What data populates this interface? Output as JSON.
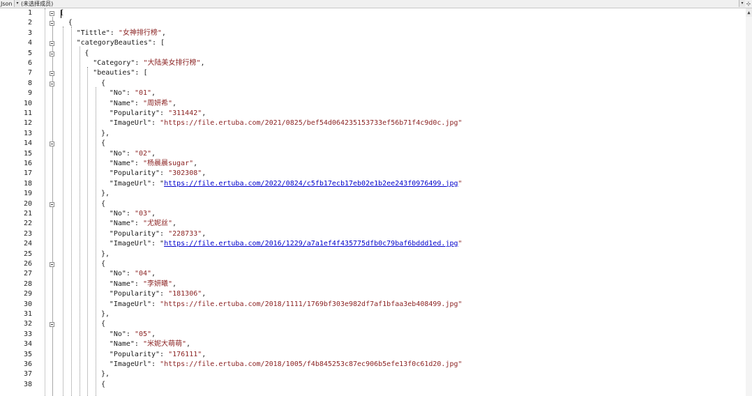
{
  "navbar": {
    "type_label": "Json",
    "member_label": "(未选择成员)",
    "dropdown_glyph": "▾",
    "split_glyph": "⊹"
  },
  "scroll": {
    "up_glyph": "▲"
  },
  "line_numbers": [
    "1",
    "2",
    "3",
    "4",
    "5",
    "6",
    "7",
    "8",
    "9",
    "10",
    "11",
    "12",
    "13",
    "14",
    "15",
    "16",
    "17",
    "18",
    "19",
    "20",
    "21",
    "22",
    "23",
    "24",
    "25",
    "26",
    "27",
    "28",
    "29",
    "30",
    "31",
    "32",
    "33",
    "34",
    "35",
    "36",
    "37",
    "38"
  ],
  "lines": [
    {
      "indent": 0,
      "parts": [
        {
          "t": "[",
          "c": "p"
        }
      ]
    },
    {
      "indent": 1,
      "parts": [
        {
          "t": "{",
          "c": "p"
        }
      ]
    },
    {
      "indent": 2,
      "parts": [
        {
          "t": "\"Tittle\"",
          "c": "k"
        },
        {
          "t": ": ",
          "c": "p"
        },
        {
          "t": "\"女神排行榜\"",
          "c": "v"
        },
        {
          "t": ",",
          "c": "p"
        }
      ]
    },
    {
      "indent": 2,
      "parts": [
        {
          "t": "\"categoryBeauties\"",
          "c": "k"
        },
        {
          "t": ": [",
          "c": "p"
        }
      ]
    },
    {
      "indent": 3,
      "parts": [
        {
          "t": "{",
          "c": "p"
        }
      ]
    },
    {
      "indent": 4,
      "parts": [
        {
          "t": "\"Category\"",
          "c": "k"
        },
        {
          "t": ": ",
          "c": "p"
        },
        {
          "t": "\"大陆美女排行榜\"",
          "c": "v"
        },
        {
          "t": ",",
          "c": "p"
        }
      ]
    },
    {
      "indent": 4,
      "parts": [
        {
          "t": "\"beauties\"",
          "c": "k"
        },
        {
          "t": ": [",
          "c": "p"
        }
      ]
    },
    {
      "indent": 5,
      "parts": [
        {
          "t": "{",
          "c": "p"
        }
      ]
    },
    {
      "indent": 6,
      "parts": [
        {
          "t": "\"No\"",
          "c": "k"
        },
        {
          "t": ": ",
          "c": "p"
        },
        {
          "t": "\"01\"",
          "c": "v"
        },
        {
          "t": ",",
          "c": "p"
        }
      ]
    },
    {
      "indent": 6,
      "parts": [
        {
          "t": "\"Name\"",
          "c": "k"
        },
        {
          "t": ": ",
          "c": "p"
        },
        {
          "t": "\"周妍希\"",
          "c": "v"
        },
        {
          "t": ",",
          "c": "p"
        }
      ]
    },
    {
      "indent": 6,
      "parts": [
        {
          "t": "\"Popularity\"",
          "c": "k"
        },
        {
          "t": ": ",
          "c": "p"
        },
        {
          "t": "\"311442\"",
          "c": "v"
        },
        {
          "t": ",",
          "c": "p"
        }
      ]
    },
    {
      "indent": 6,
      "parts": [
        {
          "t": "\"ImageUrl\"",
          "c": "k"
        },
        {
          "t": ": ",
          "c": "p"
        },
        {
          "t": "\"https://file.ertuba.com/2021/0825/bef54d064235153733ef56b71f4c9d0c.jpg\"",
          "c": "v"
        }
      ]
    },
    {
      "indent": 5,
      "parts": [
        {
          "t": "},",
          "c": "p"
        }
      ]
    },
    {
      "indent": 5,
      "parts": [
        {
          "t": "{",
          "c": "p"
        }
      ]
    },
    {
      "indent": 6,
      "parts": [
        {
          "t": "\"No\"",
          "c": "k"
        },
        {
          "t": ": ",
          "c": "p"
        },
        {
          "t": "\"02\"",
          "c": "v"
        },
        {
          "t": ",",
          "c": "p"
        }
      ]
    },
    {
      "indent": 6,
      "parts": [
        {
          "t": "\"Name\"",
          "c": "k"
        },
        {
          "t": ": ",
          "c": "p"
        },
        {
          "t": "\"杨晨晨sugar\"",
          "c": "v"
        },
        {
          "t": ",",
          "c": "p"
        }
      ]
    },
    {
      "indent": 6,
      "parts": [
        {
          "t": "\"Popularity\"",
          "c": "k"
        },
        {
          "t": ": ",
          "c": "p"
        },
        {
          "t": "\"302308\"",
          "c": "v"
        },
        {
          "t": ",",
          "c": "p"
        }
      ]
    },
    {
      "indent": 6,
      "parts": [
        {
          "t": "\"ImageUrl\"",
          "c": "k"
        },
        {
          "t": ": \"",
          "c": "p"
        },
        {
          "t": "https://file.ertuba.com/2022/0824/c5fb17ecb17eb02e1b2ee243f0976499.jpg",
          "c": "u"
        },
        {
          "t": "\"",
          "c": "v"
        }
      ]
    },
    {
      "indent": 5,
      "parts": [
        {
          "t": "},",
          "c": "p"
        }
      ]
    },
    {
      "indent": 5,
      "parts": [
        {
          "t": "{",
          "c": "p"
        }
      ]
    },
    {
      "indent": 6,
      "parts": [
        {
          "t": "\"No\"",
          "c": "k"
        },
        {
          "t": ": ",
          "c": "p"
        },
        {
          "t": "\"03\"",
          "c": "v"
        },
        {
          "t": ",",
          "c": "p"
        }
      ]
    },
    {
      "indent": 6,
      "parts": [
        {
          "t": "\"Name\"",
          "c": "k"
        },
        {
          "t": ": ",
          "c": "p"
        },
        {
          "t": "\"尤妮丝\"",
          "c": "v"
        },
        {
          "t": ",",
          "c": "p"
        }
      ]
    },
    {
      "indent": 6,
      "parts": [
        {
          "t": "\"Popularity\"",
          "c": "k"
        },
        {
          "t": ": ",
          "c": "p"
        },
        {
          "t": "\"228733\"",
          "c": "v"
        },
        {
          "t": ",",
          "c": "p"
        }
      ]
    },
    {
      "indent": 6,
      "parts": [
        {
          "t": "\"ImageUrl\"",
          "c": "k"
        },
        {
          "t": ": \"",
          "c": "p"
        },
        {
          "t": "https://file.ertuba.com/2016/1229/a7a1ef4f435775dfb0c79baf6bddd1ed.jpg",
          "c": "u"
        },
        {
          "t": "\"",
          "c": "v"
        }
      ]
    },
    {
      "indent": 5,
      "parts": [
        {
          "t": "},",
          "c": "p"
        }
      ]
    },
    {
      "indent": 5,
      "parts": [
        {
          "t": "{",
          "c": "p"
        }
      ]
    },
    {
      "indent": 6,
      "parts": [
        {
          "t": "\"No\"",
          "c": "k"
        },
        {
          "t": ": ",
          "c": "p"
        },
        {
          "t": "\"04\"",
          "c": "v"
        },
        {
          "t": ",",
          "c": "p"
        }
      ]
    },
    {
      "indent": 6,
      "parts": [
        {
          "t": "\"Name\"",
          "c": "k"
        },
        {
          "t": ": ",
          "c": "p"
        },
        {
          "t": "\"李妍曦\"",
          "c": "v"
        },
        {
          "t": ",",
          "c": "p"
        }
      ]
    },
    {
      "indent": 6,
      "parts": [
        {
          "t": "\"Popularity\"",
          "c": "k"
        },
        {
          "t": ": ",
          "c": "p"
        },
        {
          "t": "\"181306\"",
          "c": "v"
        },
        {
          "t": ",",
          "c": "p"
        }
      ]
    },
    {
      "indent": 6,
      "parts": [
        {
          "t": "\"ImageUrl\"",
          "c": "k"
        },
        {
          "t": ": ",
          "c": "p"
        },
        {
          "t": "\"https://file.ertuba.com/2018/1111/1769bf303e982df7af1bfaa3eb408499.jpg\"",
          "c": "v"
        }
      ]
    },
    {
      "indent": 5,
      "parts": [
        {
          "t": "},",
          "c": "p"
        }
      ]
    },
    {
      "indent": 5,
      "parts": [
        {
          "t": "{",
          "c": "p"
        }
      ]
    },
    {
      "indent": 6,
      "parts": [
        {
          "t": "\"No\"",
          "c": "k"
        },
        {
          "t": ": ",
          "c": "p"
        },
        {
          "t": "\"05\"",
          "c": "v"
        },
        {
          "t": ",",
          "c": "p"
        }
      ]
    },
    {
      "indent": 6,
      "parts": [
        {
          "t": "\"Name\"",
          "c": "k"
        },
        {
          "t": ": ",
          "c": "p"
        },
        {
          "t": "\"米妮大萌萌\"",
          "c": "v"
        },
        {
          "t": ",",
          "c": "p"
        }
      ]
    },
    {
      "indent": 6,
      "parts": [
        {
          "t": "\"Popularity\"",
          "c": "k"
        },
        {
          "t": ": ",
          "c": "p"
        },
        {
          "t": "\"176111\"",
          "c": "v"
        },
        {
          "t": ",",
          "c": "p"
        }
      ]
    },
    {
      "indent": 6,
      "parts": [
        {
          "t": "\"ImageUrl\"",
          "c": "k"
        },
        {
          "t": ": ",
          "c": "p"
        },
        {
          "t": "\"https://file.ertuba.com/2018/1005/f4b845253c87ec906b5efe13f0c61d20.jpg\"",
          "c": "v"
        }
      ]
    },
    {
      "indent": 5,
      "parts": [
        {
          "t": "},",
          "c": "p"
        }
      ]
    },
    {
      "indent": 5,
      "parts": [
        {
          "t": "{",
          "c": "p"
        }
      ]
    }
  ]
}
